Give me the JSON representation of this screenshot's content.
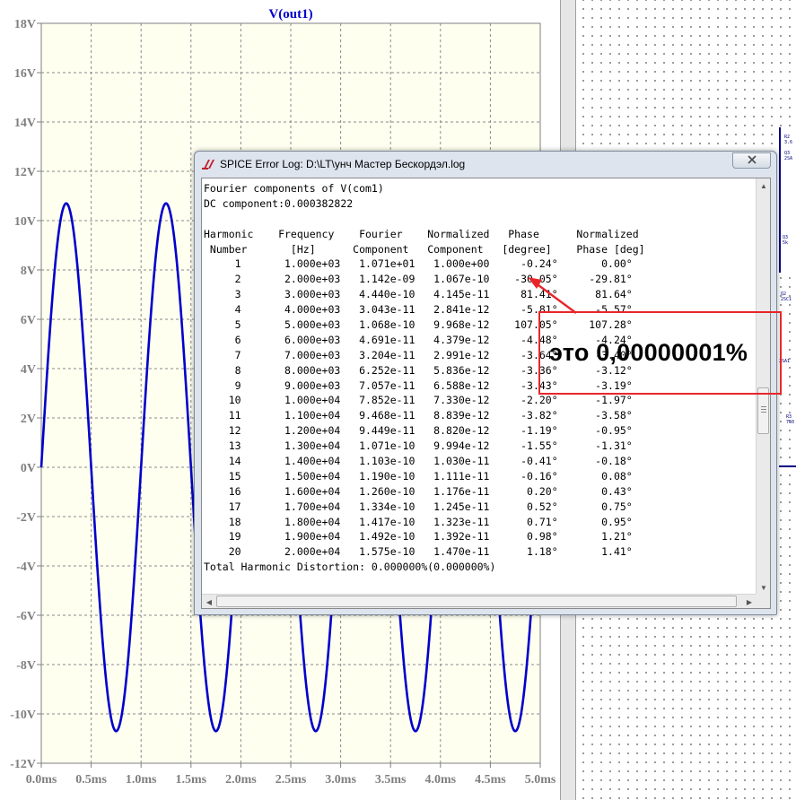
{
  "plot": {
    "title": "V(out1)",
    "background": "#fffff0",
    "trace_color": "#0000cc",
    "axis_text_color": "#7f7f7f"
  },
  "chart_data": {
    "type": "line",
    "title": "V(out1)",
    "xlabel": "",
    "ylabel": "",
    "x_unit": "ms",
    "y_unit": "V",
    "xlim": [
      0,
      5
    ],
    "ylim": [
      -12,
      18
    ],
    "x_ticks": [
      "0.0ms",
      "0.5ms",
      "1.0ms",
      "1.5ms",
      "2.0ms",
      "2.5ms",
      "3.0ms",
      "3.5ms",
      "4.0ms",
      "4.5ms",
      "5.0ms"
    ],
    "y_ticks": [
      "18V",
      "16V",
      "14V",
      "12V",
      "10V",
      "8V",
      "6V",
      "4V",
      "2V",
      "0V",
      "-2V",
      "-4V",
      "-6V",
      "-8V",
      "-10V",
      "-12V"
    ],
    "grid": true,
    "series": [
      {
        "waveform": "sine",
        "frequency_khz": 1.0,
        "amplitude_v": 10.7,
        "offset_v": 0.0,
        "phase_deg": 0,
        "x_start": 0,
        "x_end": 5
      }
    ]
  },
  "log_window": {
    "title": "SPICE Error Log: D:\\LT\\унч Мастер Бескордэл.log",
    "lines": [
      "Fourier components of V(com1)",
      "DC component:0.000382822",
      "",
      "Harmonic    Frequency    Fourier    Normalized   Phase      Normalized",
      " Number       [Hz]      Component   Component   [degree]    Phase [deg]",
      "     1       1.000e+03   1.071e+01   1.000e+00     -0.24°       0.00°",
      "     2       2.000e+03   1.142e-09   1.067e-10    -30.05°     -29.81°",
      "     3       3.000e+03   4.440e-10   4.145e-11     81.41°      81.64°",
      "     4       4.000e+03   3.043e-11   2.841e-12     -5.81°      -5.57°",
      "     5       5.000e+03   1.068e-10   9.968e-12    107.05°     107.28°",
      "     6       6.000e+03   4.691e-11   4.379e-12     -4.48°      -4.24°",
      "     7       7.000e+03   3.204e-11   2.991e-12     -3.64°      -3.40°",
      "     8       8.000e+03   6.252e-11   5.836e-12     -3.36°      -3.12°",
      "     9       9.000e+03   7.057e-11   6.588e-12     -3.43°      -3.19°",
      "    10       1.000e+04   7.852e-11   7.330e-12     -2.20°      -1.97°",
      "    11       1.100e+04   9.468e-11   8.839e-12     -3.82°      -3.58°",
      "    12       1.200e+04   9.449e-11   8.820e-12     -1.19°      -0.95°",
      "    13       1.300e+04   1.071e-10   9.994e-12     -1.55°      -1.31°",
      "    14       1.400e+04   1.103e-10   1.030e-11     -0.41°      -0.18°",
      "    15       1.500e+04   1.190e-10   1.111e-11     -0.16°       0.08°",
      "    16       1.600e+04   1.260e-10   1.176e-11      0.20°       0.43°",
      "    17       1.700e+04   1.334e-10   1.245e-11      0.52°       0.75°",
      "    18       1.800e+04   1.417e-10   1.323e-11      0.71°       0.95°",
      "    19       1.900e+04   1.492e-10   1.392e-11      0.98°       1.21°",
      "    20       2.000e+04   1.575e-10   1.470e-11      1.18°       1.41°",
      "Total Harmonic Distortion: 0.000000%(0.000000%)"
    ]
  },
  "annotation": {
    "text": "это 0,00000001%",
    "box_color": "#e8262a",
    "arrow_color": "#e8262a"
  },
  "icons": {
    "app": "ltspice-logo-icon",
    "close": "close-icon"
  }
}
